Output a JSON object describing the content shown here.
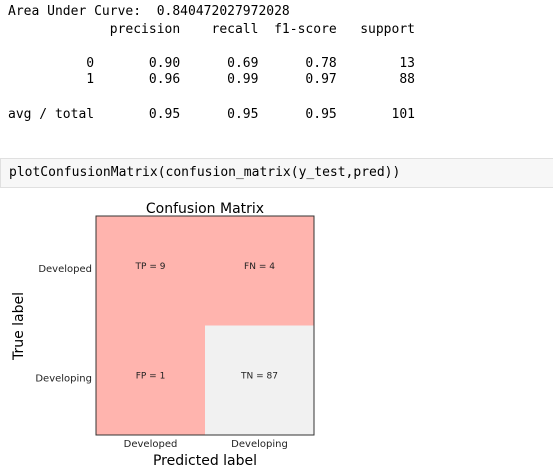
{
  "report": {
    "auc_line": "Area Under Curve:  0.840472027972028",
    "header_line": "             precision    recall  f1-score   support",
    "row0_line": "          0       0.90      0.69      0.78        13",
    "row1_line": "          1       0.96      0.99      0.97        88",
    "total_line": "avg / total       0.95      0.95      0.95       101"
  },
  "code_cell": {
    "code": "plotConfusionMatrix(confusion_matrix(y_test,pred))"
  },
  "chart_data": {
    "type": "heatmap",
    "title": "Confusion Matrix",
    "xlabel": "Predicted label",
    "ylabel": "True label",
    "x_categories": [
      "Developed",
      "Developing"
    ],
    "y_categories": [
      "Developed",
      "Developing"
    ],
    "cells": [
      {
        "row": 0,
        "col": 0,
        "label": "TP = 9",
        "value": 9,
        "color": "#ffb4ae"
      },
      {
        "row": 0,
        "col": 1,
        "label": "FN = 4",
        "value": 4,
        "color": "#ffb4ae"
      },
      {
        "row": 1,
        "col": 0,
        "label": "FP = 1",
        "value": 1,
        "color": "#ffb4ae"
      },
      {
        "row": 1,
        "col": 1,
        "label": "TN = 87",
        "value": 87,
        "color": "#f1f1f1"
      }
    ]
  }
}
